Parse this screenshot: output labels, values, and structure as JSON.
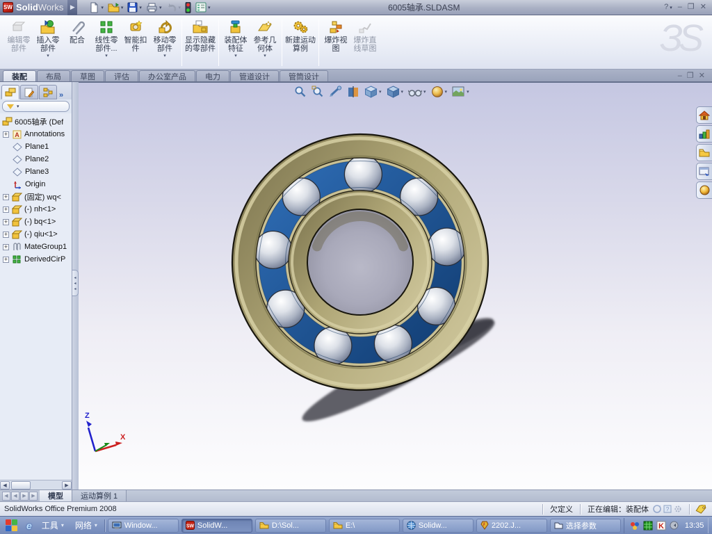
{
  "titlebar": {
    "brand_bold": "Solid",
    "brand_light": "Works",
    "title": "6005轴承.SLDASM",
    "help": "?"
  },
  "window_controls": {
    "minimize": "–",
    "restore": "❐",
    "close": "✕"
  },
  "doc_controls": {
    "minimize": "–",
    "restore": "❐",
    "close": "✕"
  },
  "quick_access_icons": [
    "new-document",
    "open-document",
    "save",
    "print",
    "undo",
    "rebuild-traffic-light",
    "options-form"
  ],
  "commandmanager": {
    "watermark": "ЗS",
    "buttons": [
      {
        "label": "编辑零部件",
        "disabled": true,
        "dropdown": false
      },
      {
        "label": "插入零部件",
        "disabled": false,
        "dropdown": true
      },
      {
        "label": "配合",
        "disabled": false,
        "dropdown": false
      },
      {
        "label": "线性零部件...",
        "disabled": false,
        "dropdown": true
      },
      {
        "label": "智能扣件",
        "disabled": false,
        "dropdown": false
      },
      {
        "label": "移动零部件",
        "disabled": false,
        "dropdown": true
      },
      {
        "label": "显示隐藏的零部件",
        "disabled": false,
        "dropdown": false
      },
      {
        "label": "装配体特征",
        "disabled": false,
        "dropdown": true
      },
      {
        "label": "参考几何体",
        "disabled": false,
        "dropdown": true
      },
      {
        "label": "新建运动算例",
        "disabled": false,
        "dropdown": false
      },
      {
        "label": "爆炸视图",
        "disabled": false,
        "dropdown": false
      },
      {
        "label": "爆炸直线草图",
        "disabled": true,
        "dropdown": false
      }
    ]
  },
  "ribbon_tabs": {
    "items": [
      {
        "label": "装配",
        "active": true
      },
      {
        "label": "布局",
        "active": false
      },
      {
        "label": "草图",
        "active": false
      },
      {
        "label": "评估",
        "active": false
      },
      {
        "label": "办公室产品",
        "active": false
      },
      {
        "label": "电力",
        "active": false
      },
      {
        "label": "管道设计",
        "active": false
      },
      {
        "label": "管筒设计",
        "active": false
      }
    ]
  },
  "feature_tree": {
    "panel_tab_icons": [
      "feature-manager-tree",
      "property-manager",
      "configuration-manager"
    ],
    "root_label": "6005轴承 (Def",
    "items": [
      {
        "label": "Annotations",
        "icon": "annotations",
        "expandable": true
      },
      {
        "label": "Plane1",
        "icon": "plane",
        "expandable": false
      },
      {
        "label": "Plane2",
        "icon": "plane",
        "expandable": false
      },
      {
        "label": "Plane3",
        "icon": "plane",
        "expandable": false
      },
      {
        "label": "Origin",
        "icon": "origin",
        "expandable": false
      },
      {
        "label": "(固定) wq<",
        "icon": "part",
        "expandable": true
      },
      {
        "label": "(-) nh<1>",
        "icon": "part",
        "expandable": true
      },
      {
        "label": "(-) bq<1>",
        "icon": "part",
        "expandable": true
      },
      {
        "label": "(-) qiu<1>",
        "icon": "part",
        "expandable": true
      },
      {
        "label": "MateGroup1",
        "icon": "mategroup",
        "expandable": true
      },
      {
        "label": "DerivedCirP",
        "icon": "circular-pattern",
        "expandable": true
      }
    ]
  },
  "viewport": {
    "headsup_icons": [
      "zoom-fit",
      "zoom-area",
      "previous-view",
      "section-view",
      "view-orientation",
      "display-style",
      "hide-show-items",
      "edit-appearance",
      "apply-scene"
    ],
    "triad": {
      "z": "Z",
      "x": "X"
    },
    "model_colors": {
      "ring": "#a89d6e",
      "cage": "#1c5ea8",
      "ball": "#c3c9d4",
      "background_top": "#c6c8e3"
    }
  },
  "taskpane_tab_icons": [
    "solidworks-resources",
    "design-library",
    "file-explorer",
    "view-palette",
    "appearances"
  ],
  "model_tabs": {
    "items": [
      {
        "label": "模型",
        "active": true
      },
      {
        "label": "运动算例 1",
        "active": false
      }
    ]
  },
  "statusbar": {
    "product": "SolidWorks Office Premium 2008",
    "definition_status": "欠定义",
    "editing": "正在编辑：装配体"
  },
  "taskbar": {
    "menus": [
      {
        "label": "工具"
      },
      {
        "label": "网络"
      }
    ],
    "buttons": [
      {
        "label": "Window...",
        "active": false
      },
      {
        "label": "SolidW...",
        "active": true
      },
      {
        "label": "D:\\Sol...",
        "active": false
      },
      {
        "label": "E:\\",
        "active": false
      },
      {
        "label": "Solidw...",
        "active": false
      },
      {
        "label": "2202.J...",
        "active": false
      },
      {
        "label": "选择参数",
        "active": false
      }
    ],
    "time": "13:35"
  }
}
